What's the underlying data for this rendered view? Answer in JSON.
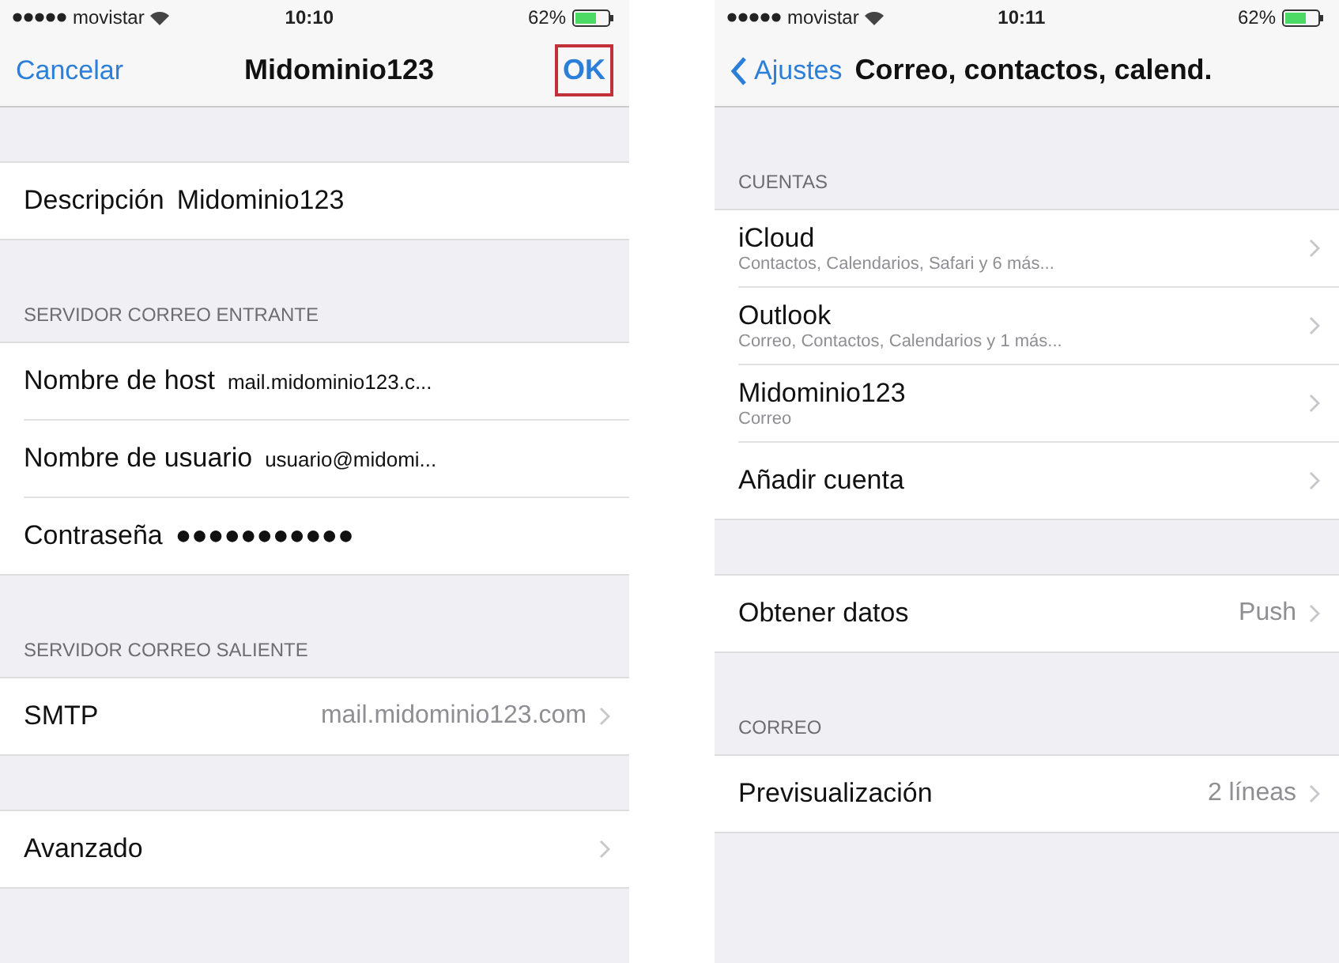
{
  "screens": [
    {
      "status_bar": {
        "carrier": "movistar",
        "time": "10:10",
        "battery": "62%"
      },
      "nav": {
        "left": "Cancelar",
        "title": "Midominio123",
        "right": {
          "label": "OK",
          "highlighted": true
        }
      },
      "sections": [
        {
          "rows": [
            {
              "kind": "field",
              "label": "Descripción",
              "value": "Midominio123",
              "small": false
            }
          ]
        },
        {
          "header": "SERVIDOR CORREO ENTRANTE",
          "rows": [
            {
              "kind": "field",
              "label": "Nombre de host",
              "value": "mail.midominio123.c...",
              "small": true
            },
            {
              "kind": "field",
              "label": "Nombre de usuario",
              "value": "usuario@midomi...",
              "small": true
            },
            {
              "kind": "field",
              "label": "Contraseña",
              "value": "●●●●●●●●●●●",
              "small": false
            }
          ]
        },
        {
          "header": "SERVIDOR CORREO SALIENTE",
          "rows": [
            {
              "kind": "disclosure",
              "label": "SMTP",
              "detail": "mail.midominio123.com"
            }
          ]
        },
        {
          "rows": [
            {
              "kind": "disclosure",
              "label": "Avanzado"
            }
          ]
        }
      ]
    },
    {
      "status_bar": {
        "carrier": "movistar",
        "time": "10:11",
        "battery": "62%"
      },
      "nav": {
        "back": "Ajustes",
        "title": "Correo, contactos, calend."
      },
      "sections": [
        {
          "header": "CUENTAS",
          "rows": [
            {
              "kind": "account",
              "label": "iCloud",
              "subtitle": "Contactos, Calendarios, Safari y 6 más..."
            },
            {
              "kind": "account",
              "label": "Outlook",
              "subtitle": "Correo, Contactos, Calendarios y 1 más..."
            },
            {
              "kind": "account",
              "label": "Midominio123",
              "subtitle": "Correo"
            },
            {
              "kind": "disclosure",
              "label": "Añadir cuenta"
            }
          ]
        },
        {
          "rows": [
            {
              "kind": "disclosure",
              "label": "Obtener datos",
              "detail": "Push"
            }
          ]
        },
        {
          "header": "CORREO",
          "rows": [
            {
              "kind": "disclosure",
              "label": "Previsualización",
              "detail": "2 líneas"
            }
          ]
        }
      ]
    }
  ]
}
